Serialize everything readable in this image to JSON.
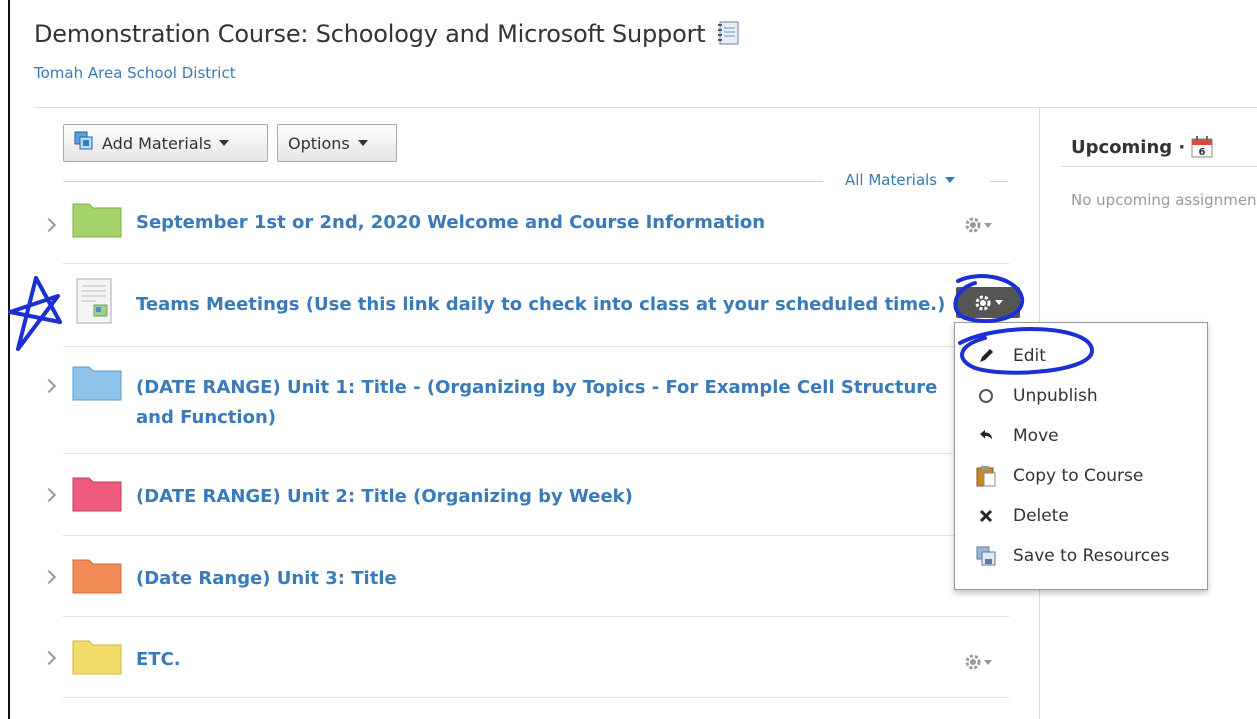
{
  "course": {
    "title": "Demonstration Course: Schoology and Microsoft Support",
    "district": "Tomah Area School District"
  },
  "toolbar": {
    "add_materials_label": "Add Materials",
    "options_label": "Options",
    "filter_label": "All Materials"
  },
  "materials": [
    {
      "title": "September 1st or 2nd, 2020 Welcome and Course Information",
      "type": "folder",
      "color": "#a5d36b"
    },
    {
      "title": "Teams Meetings (Use this link daily to check into class at your scheduled time.)",
      "type": "page"
    },
    {
      "title_line1": "(DATE RANGE) Unit 1: Title - (Organizing by Topics - For Example Cell Structure",
      "title_line2": "and Function)",
      "type": "folder",
      "color": "#8ec3ea"
    },
    {
      "title": "(DATE RANGE) Unit 2: Title (Organizing by Week)",
      "type": "folder",
      "color": "#ee5a7c"
    },
    {
      "title": "(Date Range) Unit 3: Title",
      "type": "folder",
      "color": "#f28a56"
    },
    {
      "title": "ETC.",
      "type": "folder",
      "color": "#f2dc6a"
    }
  ],
  "context_menu": {
    "items": [
      {
        "label": "Edit",
        "icon": "pencil-icon"
      },
      {
        "label": "Unpublish",
        "icon": "circle-icon"
      },
      {
        "label": "Move",
        "icon": "move-arrow-icon"
      },
      {
        "label": "Copy to Course",
        "icon": "clipboard-icon"
      },
      {
        "label": "Delete",
        "icon": "x-icon"
      },
      {
        "label": "Save to Resources",
        "icon": "save-resources-icon"
      }
    ]
  },
  "sidebar": {
    "upcoming_label": "Upcoming ·",
    "calendar_day": "6",
    "no_upcoming": "No upcoming assignments or events"
  },
  "colors": {
    "link": "#3a7ab8",
    "annotation": "#1a2fd6",
    "gear_active": "#555555"
  }
}
